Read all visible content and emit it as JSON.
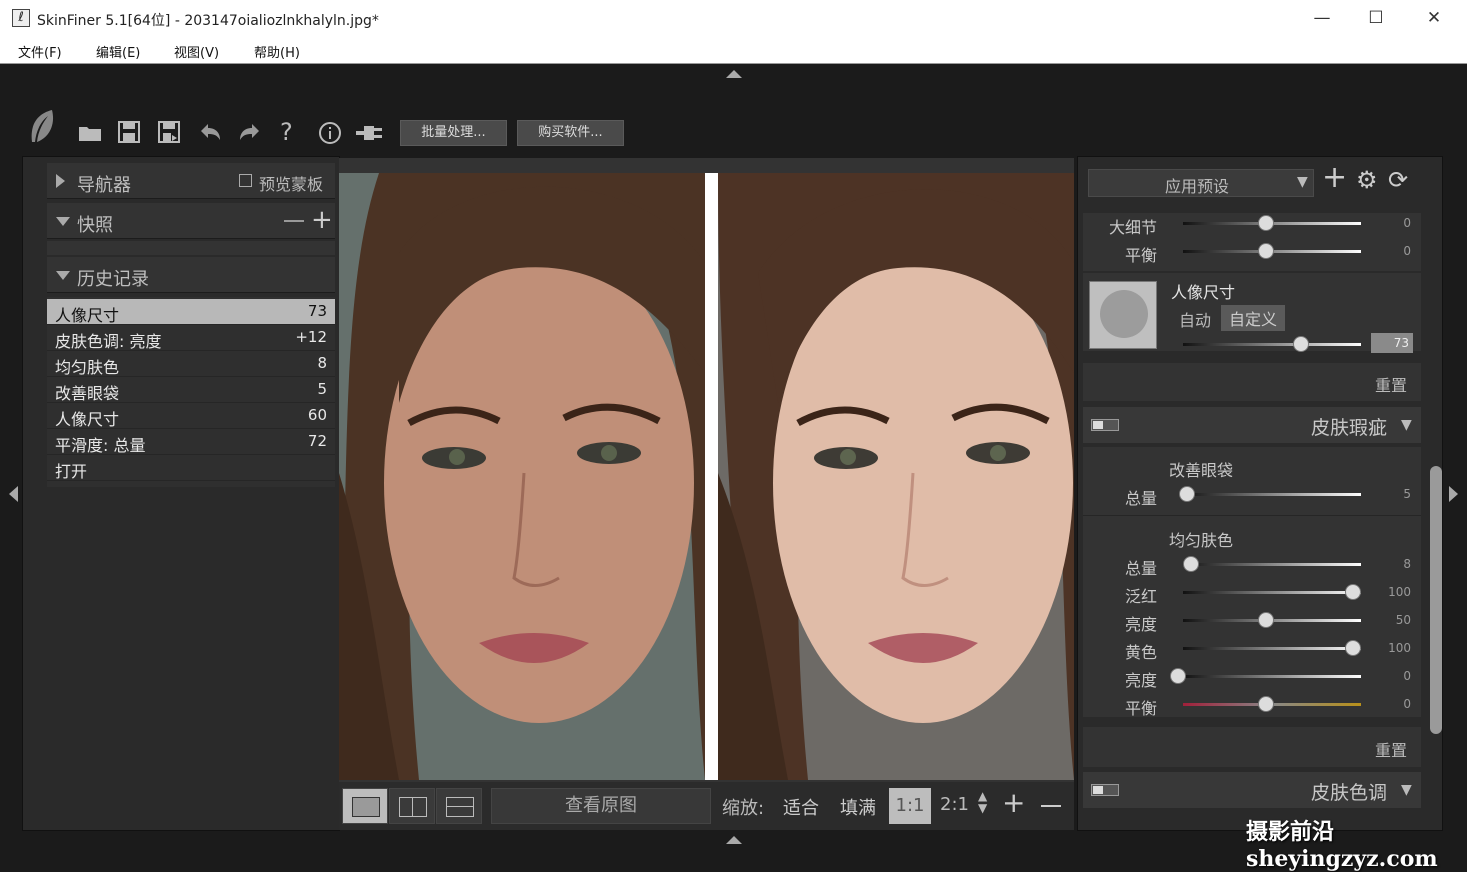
{
  "window": {
    "title": "SkinFiner 5.1[64位] - 203147oialiozlnkhalyln.jpg*",
    "minimize": "—",
    "maximize": "☐",
    "close": "✕",
    "app_icon": "leaf-icon"
  },
  "menu": [
    "文件(F)",
    "编辑(E)",
    "视图(V)",
    "帮助(H)"
  ],
  "toolbar": {
    "batch": "批量处理...",
    "buy": "购买软件..."
  },
  "left": {
    "navigator": "导航器",
    "preview_mask": "预览蒙板",
    "snapshot": "快照",
    "history": "历史记录",
    "history_items": [
      {
        "name": "人像尺寸",
        "value": "73"
      },
      {
        "name": "皮肤色调: 亮度",
        "value": "+12"
      },
      {
        "name": "均匀肤色",
        "value": "8"
      },
      {
        "name": "改善眼袋",
        "value": "5"
      },
      {
        "name": "人像尺寸",
        "value": "60"
      },
      {
        "name": "平滑度: 总量",
        "value": "72"
      },
      {
        "name": "打开",
        "value": ""
      }
    ]
  },
  "bottom": {
    "view_original": "查看原图",
    "zoom": "缩放:",
    "fit": "适合",
    "fill": "填满",
    "z11": "1:1",
    "z21": "2:1"
  },
  "right": {
    "preset": "应用预设",
    "detail": {
      "big_detail": "大细节",
      "big_detail_val": "0",
      "balance": "平衡",
      "balance_val": "0"
    },
    "portrait": {
      "title": "人像尺寸",
      "auto": "自动",
      "custom": "自定义",
      "value": "73"
    },
    "reset": "重置",
    "blemish": {
      "title": "皮肤瑕疵",
      "eyebag": "改善眼袋",
      "eyebag_total": "总量",
      "eyebag_total_val": "5",
      "even": "均匀肤色",
      "rows": [
        {
          "label": "总量",
          "val": "8"
        },
        {
          "label": "泛红",
          "val": "100"
        },
        {
          "label": "亮度",
          "val": "50"
        },
        {
          "label": "黄色",
          "val": "100"
        },
        {
          "label": "亮度",
          "val": "0"
        },
        {
          "label": "平衡",
          "val": "0"
        }
      ]
    },
    "tone": "皮肤色调"
  },
  "watermark": "摄影前沿 sheyingzyz.com"
}
